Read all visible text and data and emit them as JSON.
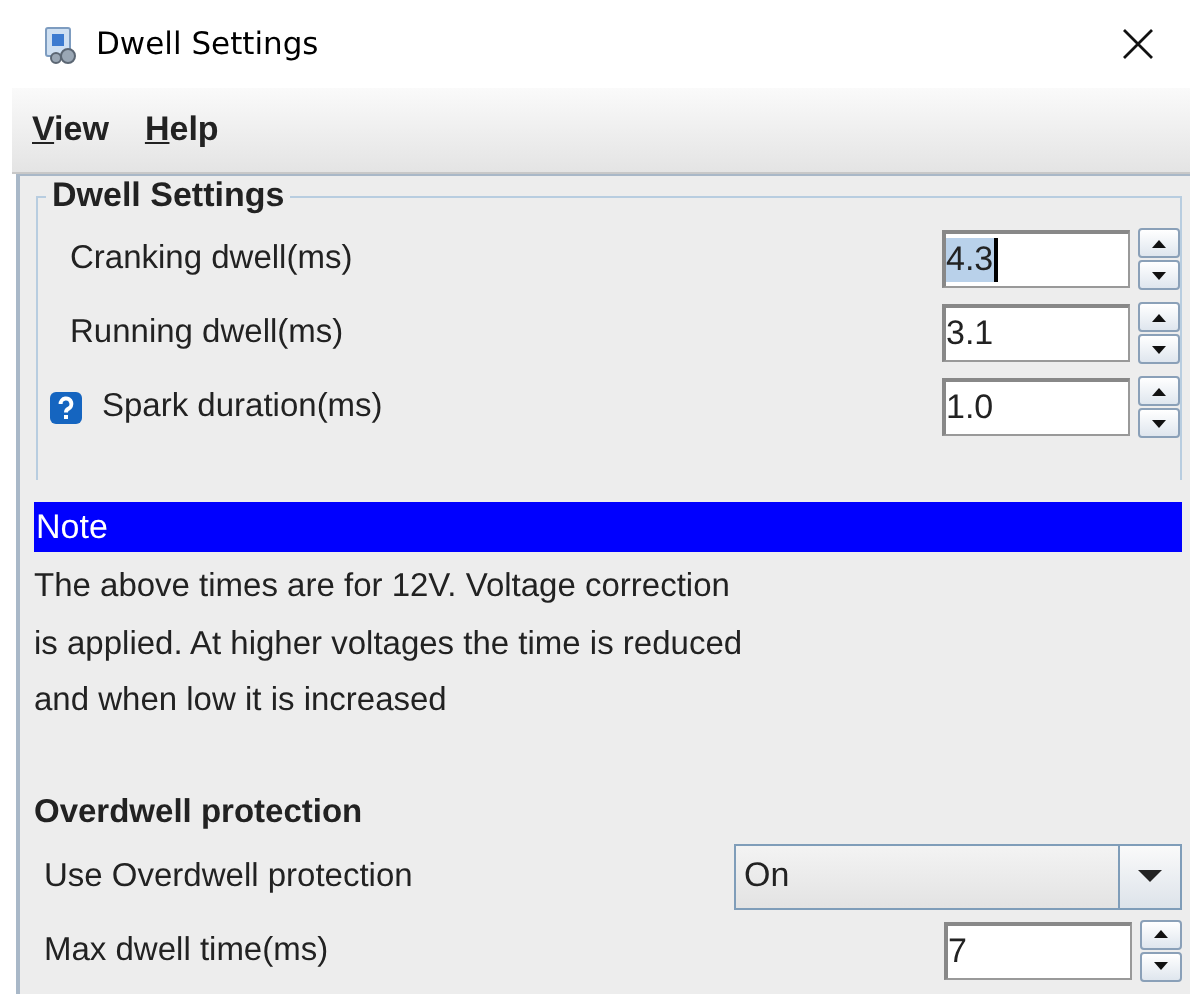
{
  "window": {
    "title": "Dwell Settings"
  },
  "menu": [
    {
      "label": "View"
    },
    {
      "label": "Help"
    }
  ],
  "dwell_settings": {
    "title": "Dwell Settings",
    "rows": [
      {
        "kind": "plain",
        "label": "Cranking dwell(ms)",
        "value": "4.3",
        "value_selected": true
      },
      {
        "kind": "plain",
        "label": "Running dwell(ms)",
        "value": "3.1",
        "value_selected": false
      },
      {
        "kind": "help",
        "label": "Spark duration(ms)",
        "value": "1.0",
        "value_selected": false
      }
    ],
    "note": {
      "title": "Note",
      "lines": [
        "The above times are for 12V. Voltage correction",
        "is applied. At higher voltages the time is reduced",
        "and when low it is increased"
      ]
    },
    "overdwell": {
      "title": "Overdwell protection",
      "rows": [
        {
          "kind": "combo",
          "label": "Use Overdwell protection",
          "value": "On"
        },
        {
          "kind": "spinner",
          "label": "Max dwell time(ms)",
          "value": "7"
        }
      ]
    }
  }
}
